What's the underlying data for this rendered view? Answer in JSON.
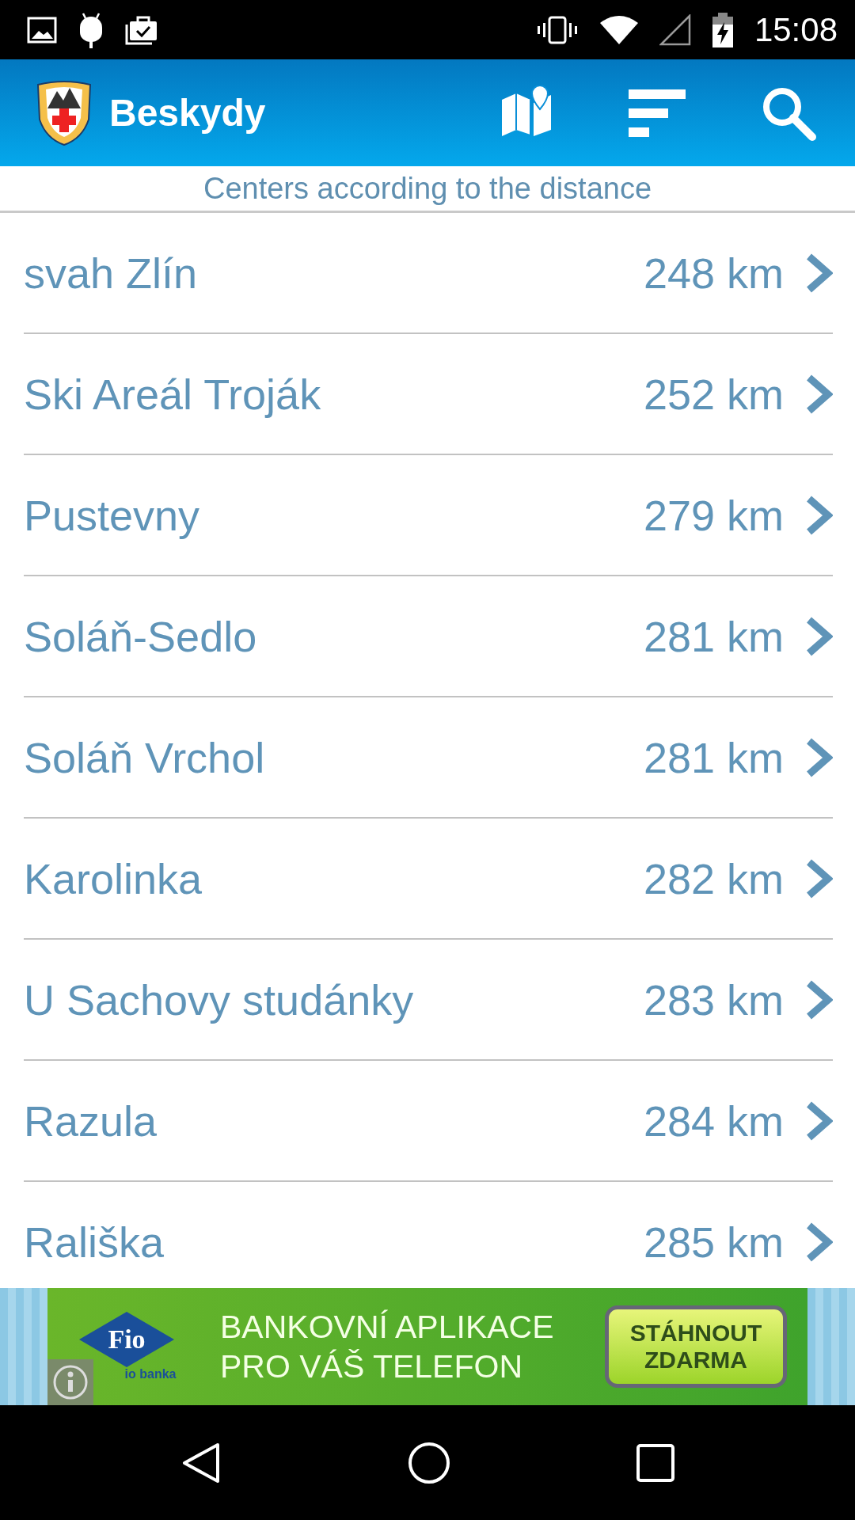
{
  "status_bar": {
    "time": "15:08"
  },
  "app_bar": {
    "title": "Beskydy"
  },
  "subtitle": "Centers according to the distance",
  "centers": [
    {
      "name": "svah Zlín",
      "distance": "248 km"
    },
    {
      "name": "Ski Areál Troják",
      "distance": "252 km"
    },
    {
      "name": "Pustevny",
      "distance": "279 km"
    },
    {
      "name": "Soláň-Sedlo",
      "distance": "281 km"
    },
    {
      "name": "Soláň Vrchol",
      "distance": "281 km"
    },
    {
      "name": "Karolinka",
      "distance": "282 km"
    },
    {
      "name": "U Sachovy studánky",
      "distance": "283 km"
    },
    {
      "name": "Razula",
      "distance": "284 km"
    },
    {
      "name": "Rališka",
      "distance": "285 km"
    }
  ],
  "ad": {
    "logo": "Fio",
    "brand": "io banka",
    "headline": [
      "BANKOVNÍ APLIKACE",
      "PRO VÁŠ TELEFON"
    ],
    "button": [
      "STÁHNOUT",
      "ZDARMA"
    ]
  }
}
